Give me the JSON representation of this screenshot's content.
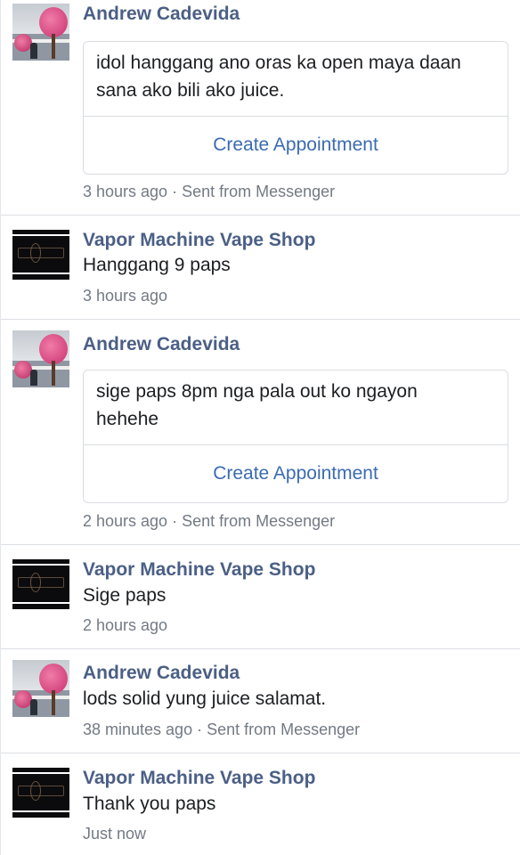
{
  "messages": [
    {
      "sender": "Andrew Cadevida",
      "avatar_icon": "andrew-profile-photo",
      "type": "card",
      "text_lines": [
        "idol hanggang ano oras ka open maya daan",
        "sana ako bili ako juice."
      ],
      "action_label": "Create Appointment",
      "meta": "3 hours ago · Sent from Messenger"
    },
    {
      "sender": "Vapor Machine Vape Shop",
      "avatar_icon": "vapor-machine-logo",
      "type": "text",
      "text": "Hanggang 9 paps",
      "meta": "3 hours ago"
    },
    {
      "sender": "Andrew Cadevida",
      "avatar_icon": "andrew-profile-photo",
      "type": "card",
      "text_lines": [
        "sige paps 8pm nga pala out ko ngayon",
        "hehehe"
      ],
      "action_label": "Create Appointment",
      "meta": "2 hours ago · Sent from Messenger"
    },
    {
      "sender": "Vapor Machine Vape Shop",
      "avatar_icon": "vapor-machine-logo",
      "type": "text",
      "text": "Sige paps",
      "meta": "2 hours ago"
    },
    {
      "sender": "Andrew Cadevida",
      "avatar_icon": "andrew-profile-photo",
      "type": "text",
      "text": "lods solid yung juice salamat.",
      "meta": "38 minutes ago · Sent from Messenger"
    },
    {
      "sender": "Vapor Machine Vape Shop",
      "avatar_icon": "vapor-machine-logo",
      "type": "text",
      "text": "Thank you paps",
      "meta": "Just now"
    }
  ],
  "colors": {
    "sender_name": "#4b5f86",
    "link": "#3b6bb1",
    "meta": "#737a84",
    "divider": "#dddfe2"
  }
}
